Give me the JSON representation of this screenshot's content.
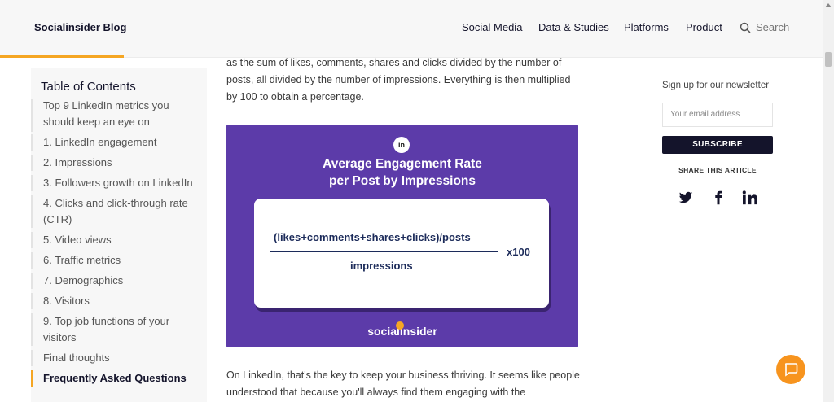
{
  "header": {
    "brand": "Socialinsider Blog",
    "nav": [
      "Social Media",
      "Data & Studies",
      "Platforms",
      "Product"
    ],
    "search_label": "Search"
  },
  "toc": {
    "title": "Table of Contents",
    "items": [
      "Top 9 LinkedIn metrics you should keep an eye on",
      "1. LinkedIn engagement",
      "2. Impressions",
      "3. Followers growth on LinkedIn",
      "4. Clicks and click-through rate (CTR)",
      "5. Video views",
      "6. Traffic metrics",
      "7. Demographics",
      "8. Visitors",
      "9. Top job functions of your visitors",
      "Final thoughts",
      "Frequently Asked Questions"
    ]
  },
  "article": {
    "para1": "as the sum of likes, comments, shares and clicks divided by the number of posts, all divided by the number of impressions. Everything is then multiplied by 100 to obtain a percentage.",
    "para2": "On LinkedIn, that's the key to keep your business thriving. It seems like people understood that because you'll always find them engaging with the"
  },
  "figure": {
    "badge": "in",
    "title_line1": "Average Engagement Rate",
    "title_line2": "per Post by Impressions",
    "numerator": "(likes+comments+shares+clicks)/posts",
    "denominator": "impressions",
    "multiplier": "x100",
    "brand": "socialinsider"
  },
  "sidebar": {
    "newsletter_label": "Sign up for our newsletter",
    "email_placeholder": "Your email address",
    "subscribe_label": "SUBSCRIBE",
    "share_label": "SHARE THIS ARTICLE"
  },
  "icons": {
    "search": "search-icon",
    "twitter": "twitter-icon",
    "facebook": "facebook-icon",
    "linkedin": "linkedin-icon",
    "chat": "chat-icon"
  },
  "colors": {
    "accent": "#f5a623",
    "figure_bg": "#5c3ba9",
    "dark": "#14142b",
    "chat": "#f7941e"
  }
}
